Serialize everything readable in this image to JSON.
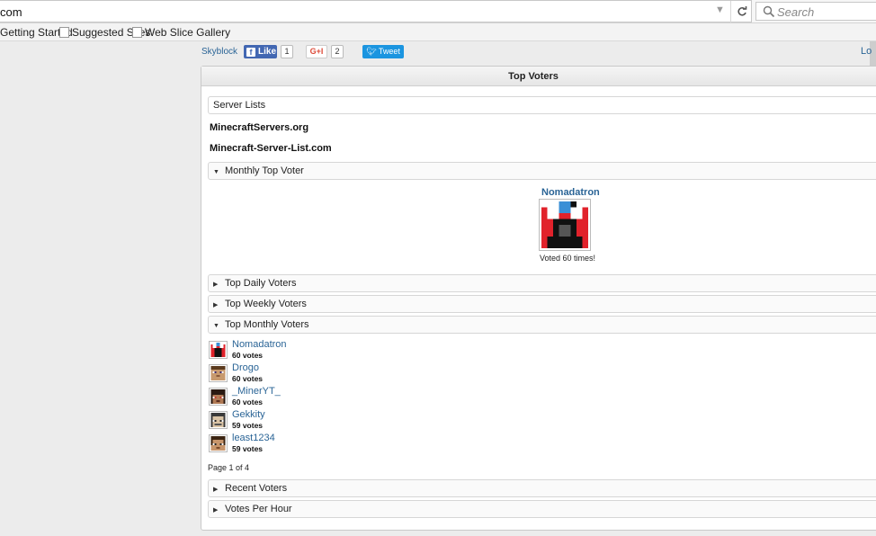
{
  "browser": {
    "url": "com",
    "search_placeholder": "Search",
    "refresh_glyph": "C",
    "dropdown_glyph": "▼",
    "bookmarks": [
      {
        "label": "Getting Started"
      },
      {
        "label": "Suggested Sites"
      },
      {
        "label": "Web Slice Gallery"
      }
    ]
  },
  "social": {
    "breadcrumb": "Skyblock",
    "like_label": "Like",
    "like_count": "1",
    "gplus_label": "G+I",
    "gplus_count": "2",
    "tweet_label": "Tweet",
    "login_partial": "Lo"
  },
  "panel": {
    "title": "Top Voters",
    "server_lists_label": "Server Lists",
    "servers": [
      "MinecraftServers.org",
      "Minecraft-Server-List.com"
    ],
    "monthly_top_label": "Monthly Top Voter",
    "monthly_top": {
      "name": "Nomadatron",
      "voted_text": "Voted 60 times!"
    },
    "sections_collapsed_before": [
      "Top Daily Voters",
      "Top Weekly Voters"
    ],
    "top_monthly_label": "Top Monthly Voters",
    "voters": [
      {
        "name": "Nomadatron",
        "votes": "60 votes",
        "avatar": "red-creature-icon"
      },
      {
        "name": "Drogo",
        "votes": "60 votes",
        "avatar": "tan-face-icon"
      },
      {
        "name": "_MinerYT_",
        "votes": "60 votes",
        "avatar": "dark-face-icon"
      },
      {
        "name": "Gekkity",
        "votes": "59 votes",
        "avatar": "grey-face-icon"
      },
      {
        "name": "least1234",
        "votes": "59 votes",
        "avatar": "brown-face-icon"
      }
    ],
    "page_info": "Page 1 of 4",
    "sections_collapsed_after": [
      "Recent Voters",
      "Votes Per Hour"
    ]
  },
  "colors": {
    "link": "#2a6496",
    "facebook": "#4267b2",
    "twitter": "#1b95e0",
    "avatar_red": "#e1222b",
    "avatar_blue": "#3a8fd6"
  }
}
